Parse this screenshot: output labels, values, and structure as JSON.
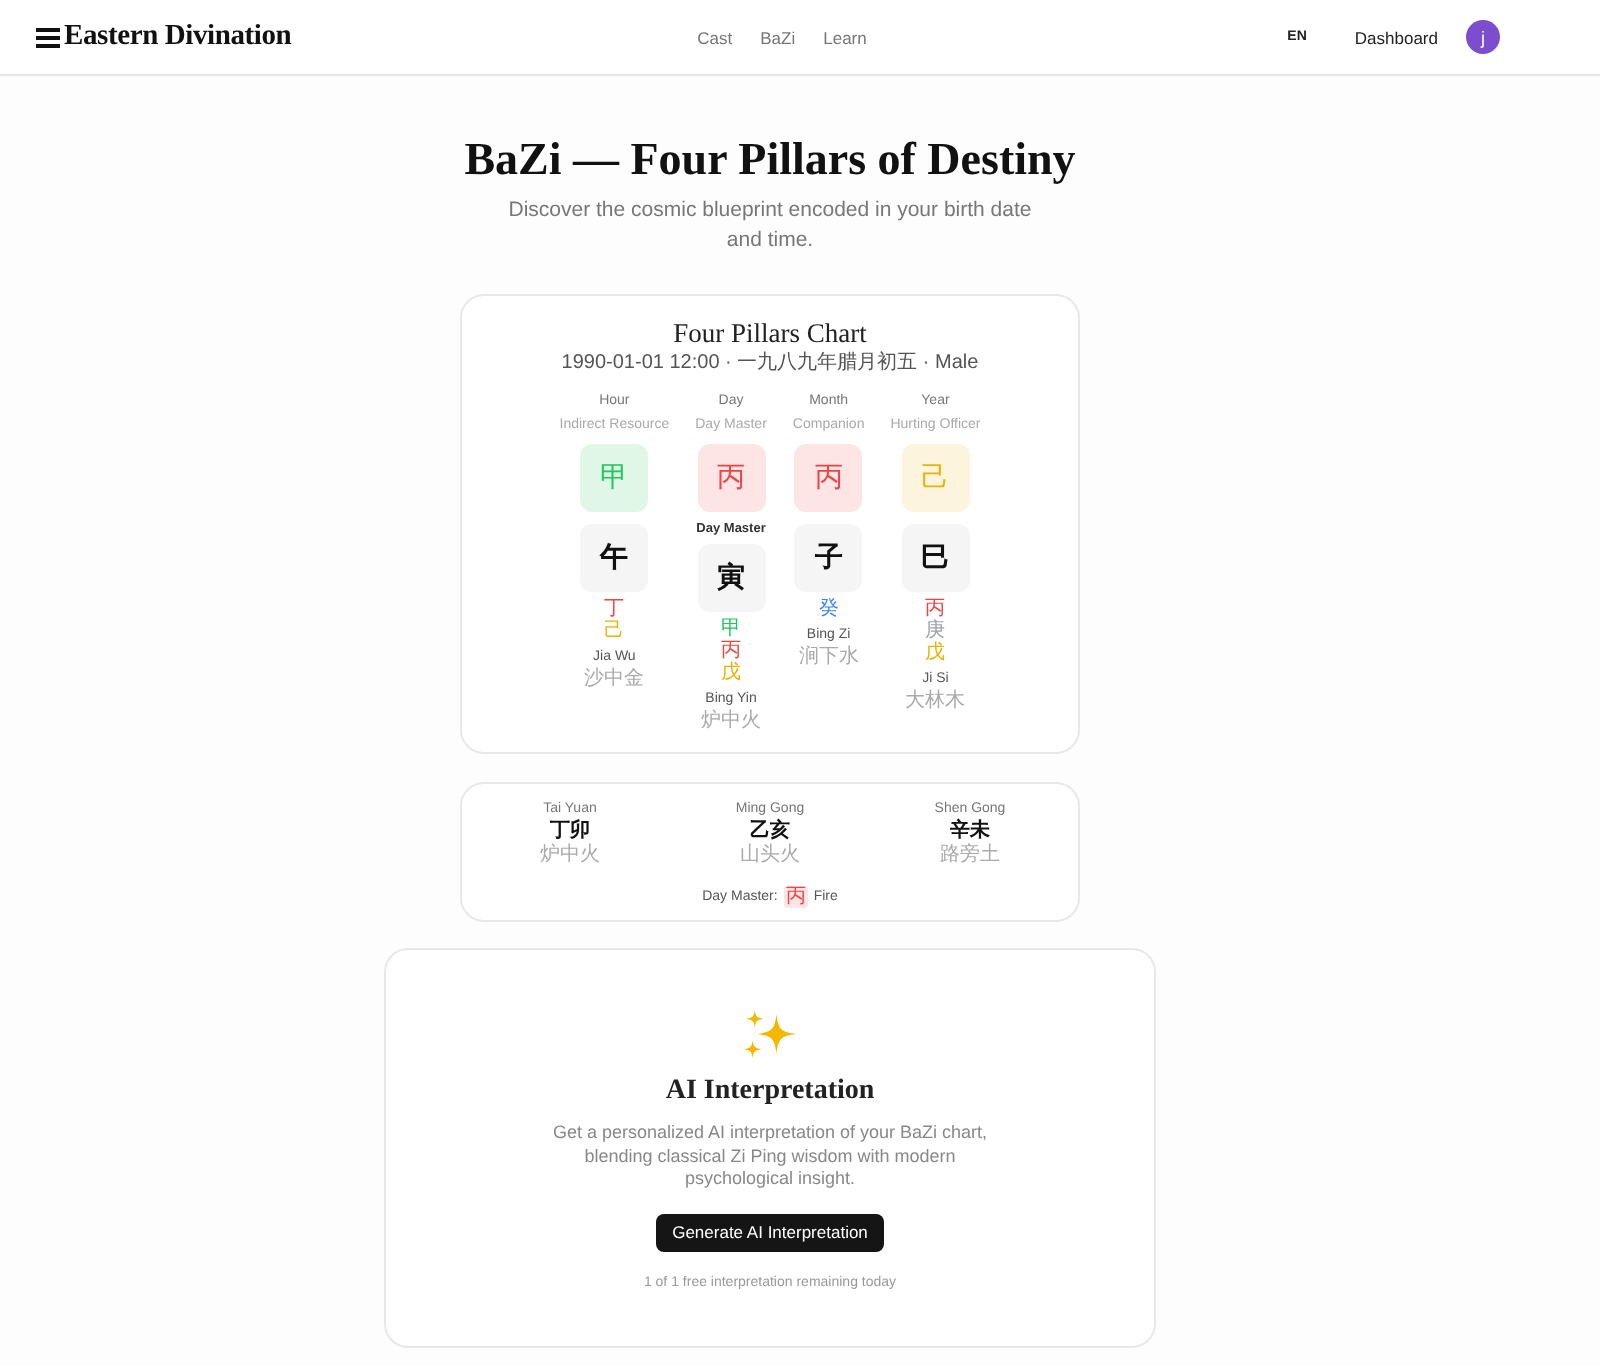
{
  "header": {
    "brand": "Eastern Divination",
    "nav": [
      {
        "label": "Cast",
        "selected": false
      },
      {
        "label": "BaZi",
        "selected": false
      },
      {
        "label": "Learn",
        "selected": false
      }
    ],
    "language": {
      "label": "EN",
      "selected": true
    },
    "dashboard": "Dashboard",
    "avatar_initial": "j"
  },
  "hero": {
    "title": "BaZi — Four Pillars of Destiny",
    "subtitle": "Discover the cosmic blueprint encoded in your birth date and time."
  },
  "chart": {
    "title": "Four Pillars Chart",
    "birth_info": "1990-01-01 12:00 · 一九八九年腊月初五 · Male",
    "pillars": [
      {
        "position": "Hour",
        "ten_god": "Indirect Resource",
        "stem": {
          "char": "甲",
          "color": "#22c55e"
        },
        "branch": "午",
        "hidden_stems": [
          {
            "char": "丁",
            "color": "#ef4444"
          },
          {
            "char": "己",
            "color": "#eab308"
          }
        ],
        "name": "Jia Wu",
        "nayin": "沙中金"
      },
      {
        "position": "Day",
        "ten_god": "Day Master",
        "stem": {
          "char": "丙",
          "color": "#ef4444"
        },
        "day_master_label": "Day Master",
        "branch": "寅",
        "hidden_stems": [
          {
            "char": "甲",
            "color": "#22c55e"
          },
          {
            "char": "丙",
            "color": "#ef4444"
          },
          {
            "char": "戊",
            "color": "#eab308"
          }
        ],
        "name": "Bing Yin",
        "nayin": "炉中火"
      },
      {
        "position": "Month",
        "ten_god": "Companion",
        "stem": {
          "char": "丙",
          "color": "#ef4444"
        },
        "branch": "子",
        "hidden_stems": [
          {
            "char": "癸",
            "color": "#3b82f6"
          }
        ],
        "name": "Bing Zi",
        "nayin": "涧下水"
      },
      {
        "position": "Year",
        "ten_god": "Hurting Officer",
        "stem": {
          "char": "己",
          "color": "#eab308"
        },
        "branch": "巳",
        "hidden_stems": [
          {
            "char": "丙",
            "color": "#ef4444"
          },
          {
            "char": "庚",
            "color": "#9ca3af"
          },
          {
            "char": "戊",
            "color": "#eab308"
          }
        ],
        "name": "Ji Si",
        "nayin": "大林木"
      }
    ]
  },
  "palaces": {
    "items": [
      {
        "label": "Tai Yuan",
        "pillar": "丁卯",
        "nayin": "炉中火"
      },
      {
        "label": "Ming Gong",
        "pillar": "乙亥",
        "nayin": "山头火"
      },
      {
        "label": "Shen Gong",
        "pillar": "辛未",
        "nayin": "路旁土"
      }
    ],
    "day_master": {
      "label": "Day Master:",
      "stem": "丙",
      "color": "#ef4444",
      "element": "Fire"
    }
  },
  "ai": {
    "title": "AI Interpretation",
    "description": "Get a personalized AI interpretation of your BaZi chart, blending classical Zi Ping wisdom with modern psychological insight.",
    "button": "Generate AI Interpretation",
    "quota": "1 of 1 free interpretation remaining today"
  }
}
